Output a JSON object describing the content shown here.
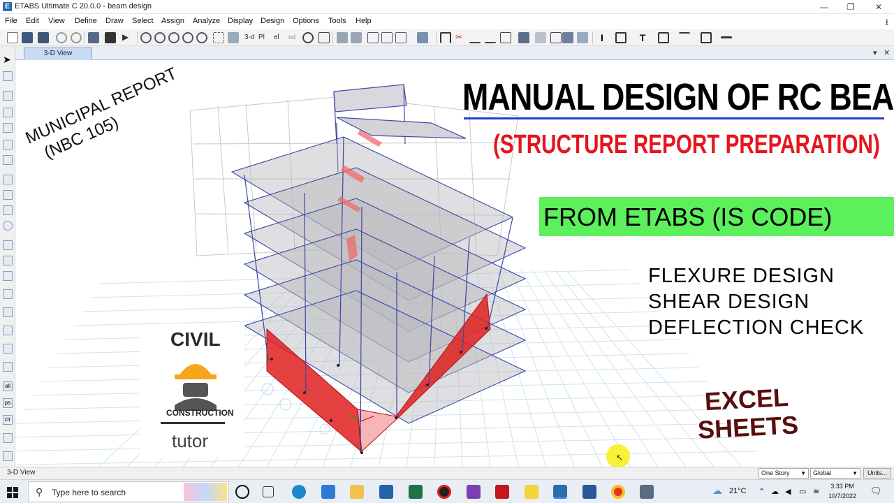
{
  "window": {
    "title": "ETABS Ultimate C 20.0.0 - beam design",
    "app_icon": "E",
    "controls": [
      "—",
      "❐",
      "✕"
    ]
  },
  "menu": [
    "File",
    "Edit",
    "View",
    "Define",
    "Draw",
    "Select",
    "Assign",
    "Analyze",
    "Display",
    "Design",
    "Options",
    "Tools",
    "Help"
  ],
  "toolbar": {
    "view_3d": "3-d",
    "plan": "Pl",
    "elev": "el",
    "nd": "nd"
  },
  "tab": {
    "label": "3-D View",
    "controls": [
      "▾",
      "✕"
    ]
  },
  "overlay": {
    "main_title": "MANUAL DESIGN OF RC BEAM",
    "sub_title": "(STRUCTURE REPORT PREPARATION)",
    "etabs_label": "FROM ETABS (IS CODE)",
    "design_items": [
      "FLEXURE DESIGN",
      "SHEAR DESIGN",
      "DEFLECTION CHECK"
    ],
    "municipal_lines": [
      "MUNICIPAL REPORT",
      "(NBC 105)"
    ],
    "excel_lines": [
      "EXCEL",
      "SHEETS"
    ],
    "colors": {
      "title_red": "#e8141c",
      "green_box": "#5cf05c",
      "underline_blue": "#1d3fc4",
      "wall_red": "#e02020"
    }
  },
  "logo": {
    "civil_c": "C",
    "civil_i": "I",
    "civil_vil": "VIL",
    "construction": "CONSTRUCTION",
    "tutor": "tutor"
  },
  "statusbar": {
    "view_label": "3-D View",
    "story_select": "One Story",
    "coord_select": "Global",
    "units_button": "Units..."
  },
  "taskbar": {
    "search_placeholder": "Type here to search",
    "weather": "21°C",
    "time": "3:33 PM",
    "date": "10/7/2022",
    "icons": [
      "start-icon",
      "cortana-icon",
      "task-view-icon",
      "edge-icon",
      "store-icon",
      "file-explorer-icon",
      "skype-icon",
      "excel-icon",
      "record-icon",
      "gdrive-icon",
      "autocad-icon",
      "sticky-notes-icon",
      "etabs-icon",
      "word-icon",
      "chrome-icon",
      "calculator-icon"
    ]
  }
}
